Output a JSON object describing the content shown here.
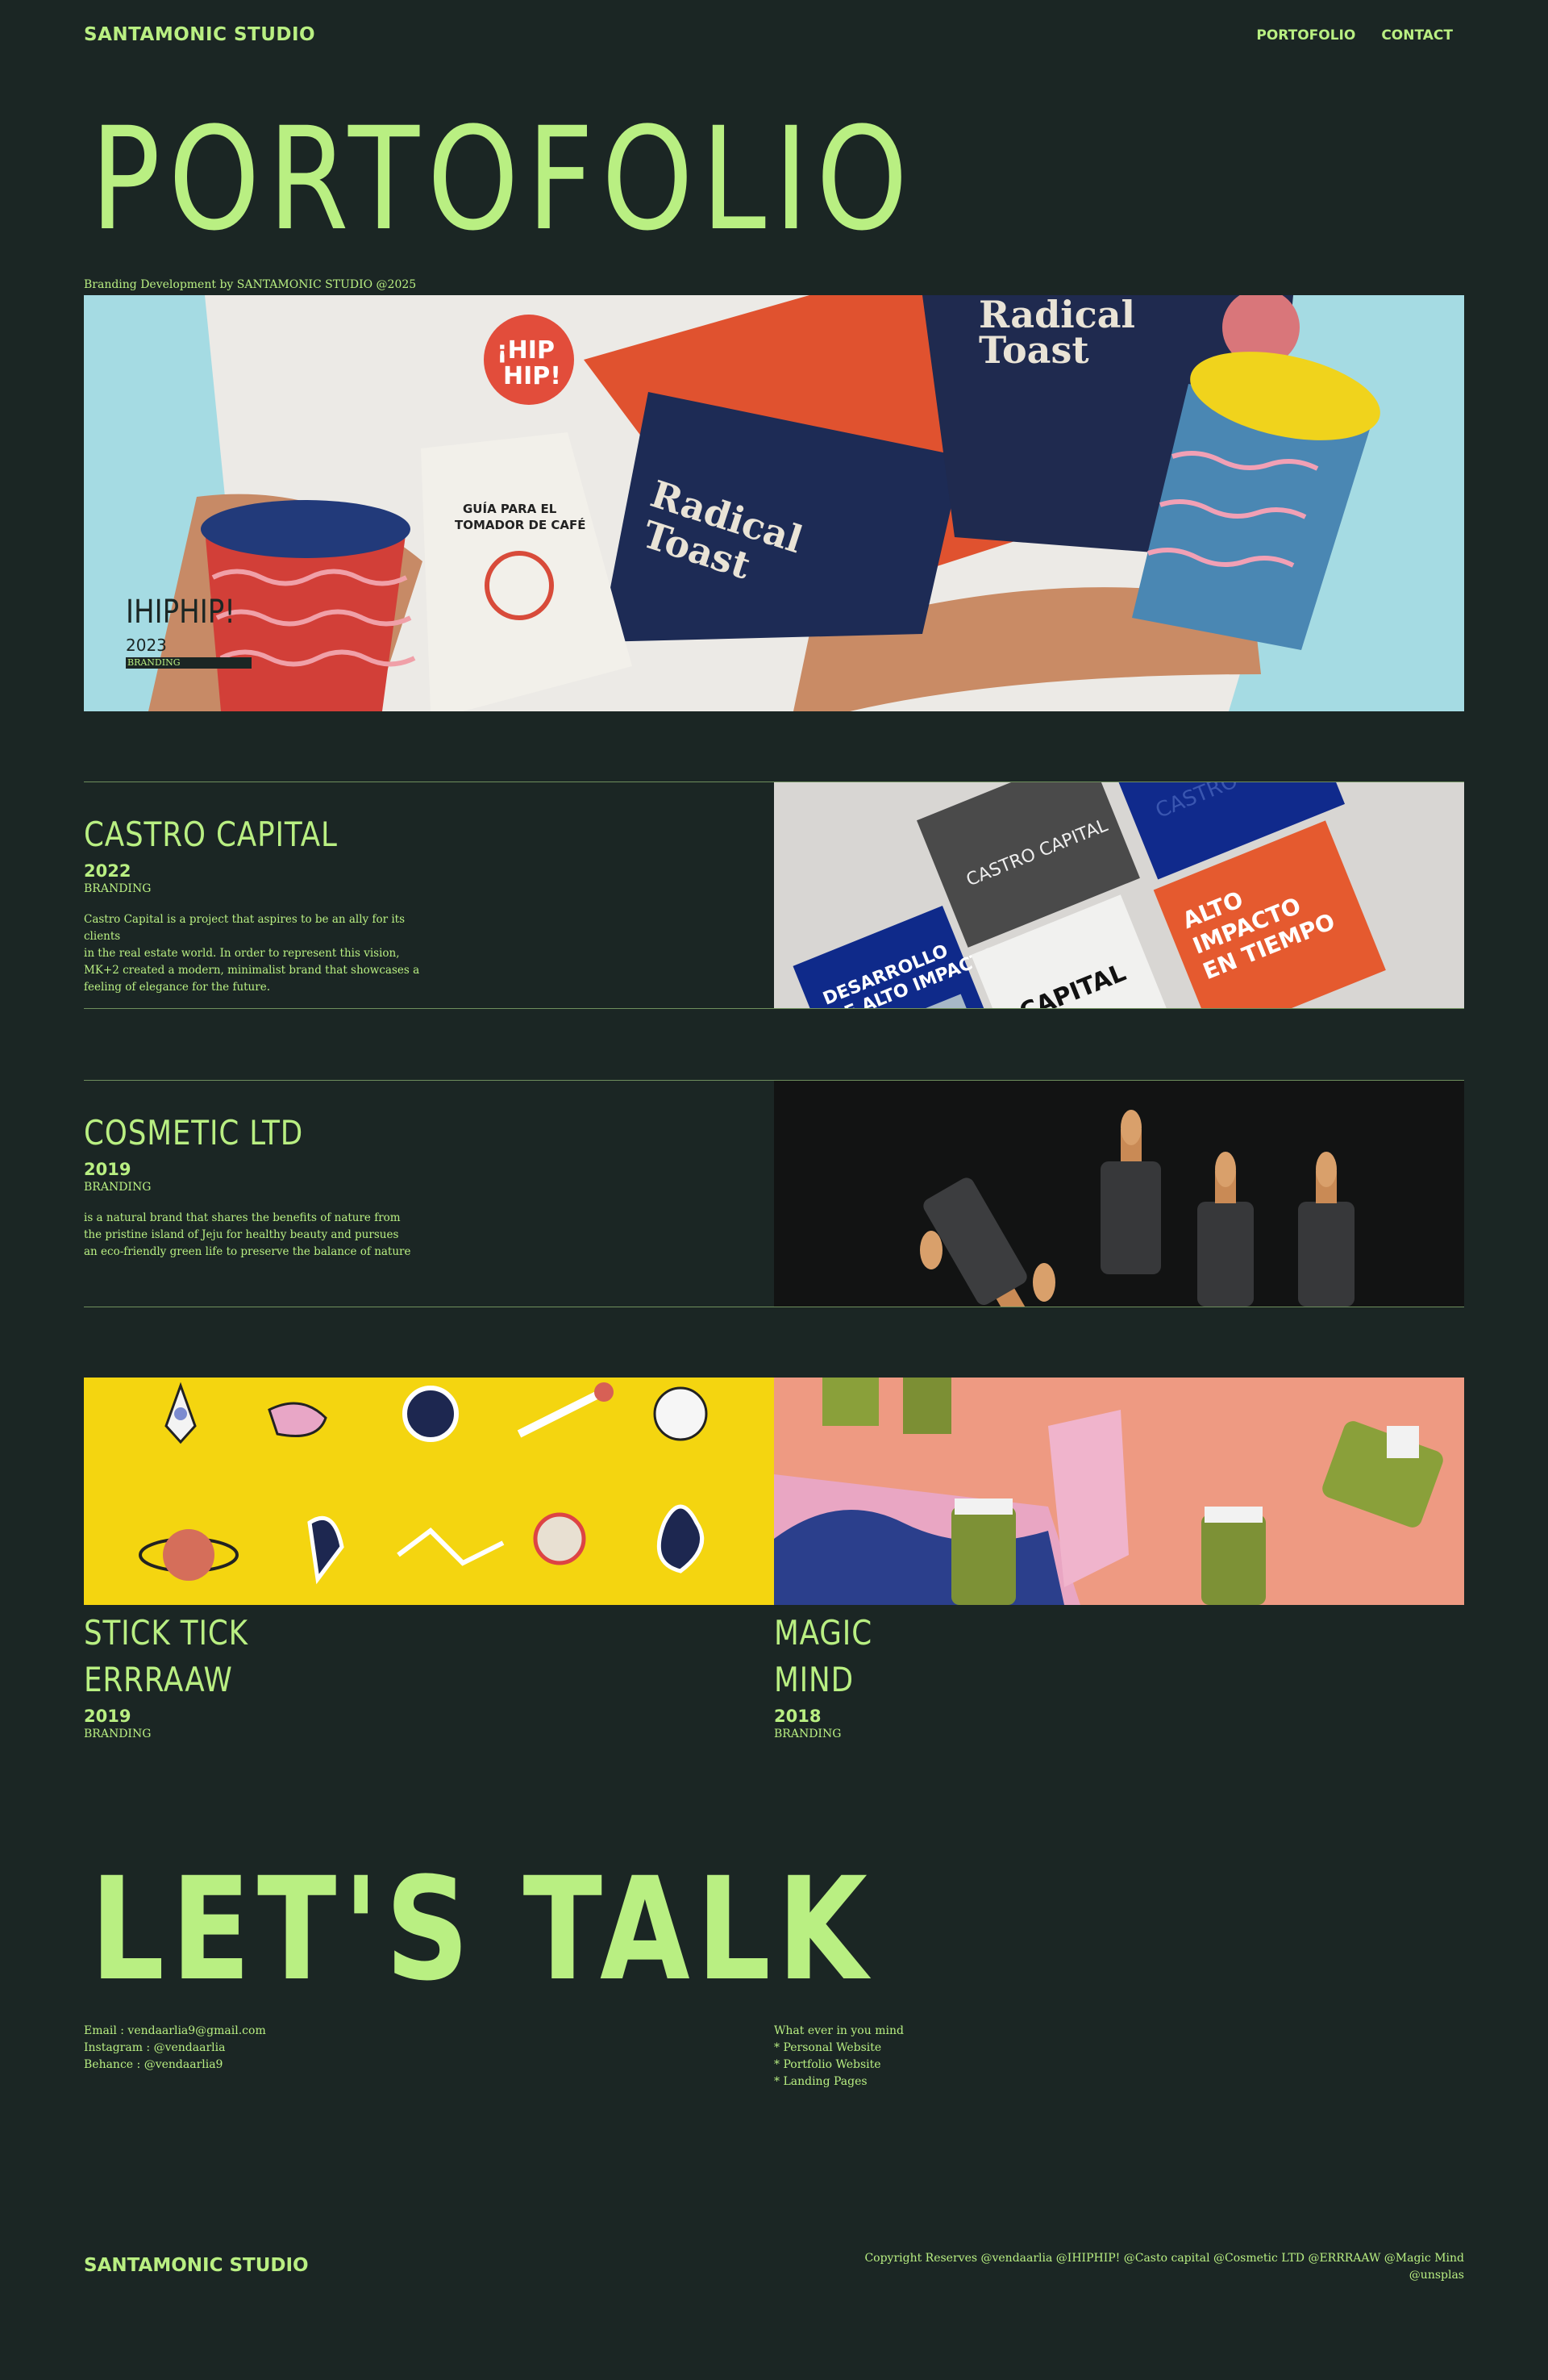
{
  "header": {
    "brand": "SANTAMONIC STUDIO",
    "nav": [
      "PORTOFOLIO",
      "CONTACT"
    ]
  },
  "hero": {
    "title": "PORTOFOLIO",
    "subtitle": "Branding Development by SANTAMONIC STUDIO @2025"
  },
  "featured": {
    "title": "IHIPHIP!",
    "year": "2023",
    "tag": "BRANDING"
  },
  "projects": [
    {
      "title": "CASTRO CAPITAL",
      "year": "2022",
      "tag": "BRANDING",
      "description": [
        "Castro Capital is a project that aspires to be an ally for its clients",
        "in the real estate world. In order to represent this vision,",
        "MK+2 created a modern, minimalist brand that showcases a",
        "feeling of elegance for the future."
      ]
    },
    {
      "title": "COSMETIC LTD",
      "year": "2019",
      "tag": "BRANDING",
      "description": [
        "is a natural brand that shares the benefits of nature from",
        "the pristine island of Jeju for healthy beauty and pursues",
        "an eco-friendly green life to preserve the balance of nature"
      ]
    }
  ],
  "tiles": [
    {
      "title_line1": "STICK TICK",
      "title_line2": "ERRRAAW",
      "year": "2019",
      "tag": "BRANDING"
    },
    {
      "title_line1": "MAGIC",
      "title_line2": "MIND",
      "year": "2018",
      "tag": "BRANDING"
    }
  ],
  "talk": {
    "title": "LET'S TALK",
    "contact": [
      "Email : vendaarlia9@gmail.com",
      "Instagram : @vendaarlia",
      "Behance : @vendaarlia9"
    ],
    "services": [
      "What ever in you mind",
      "* Personal Website",
      "* Portfolio Website",
      "* Landing Pages"
    ]
  },
  "footer": {
    "brand": "SANTAMONIC STUDIO",
    "copyright": "Copyright Reserves @vendaarlia @IHIPHIP! @Casto capital @Cosmetic LTD @ERRRAAW @Magic Mind @unsplas"
  },
  "colors": {
    "background": "#1b2624",
    "accent": "#b9ef82"
  }
}
